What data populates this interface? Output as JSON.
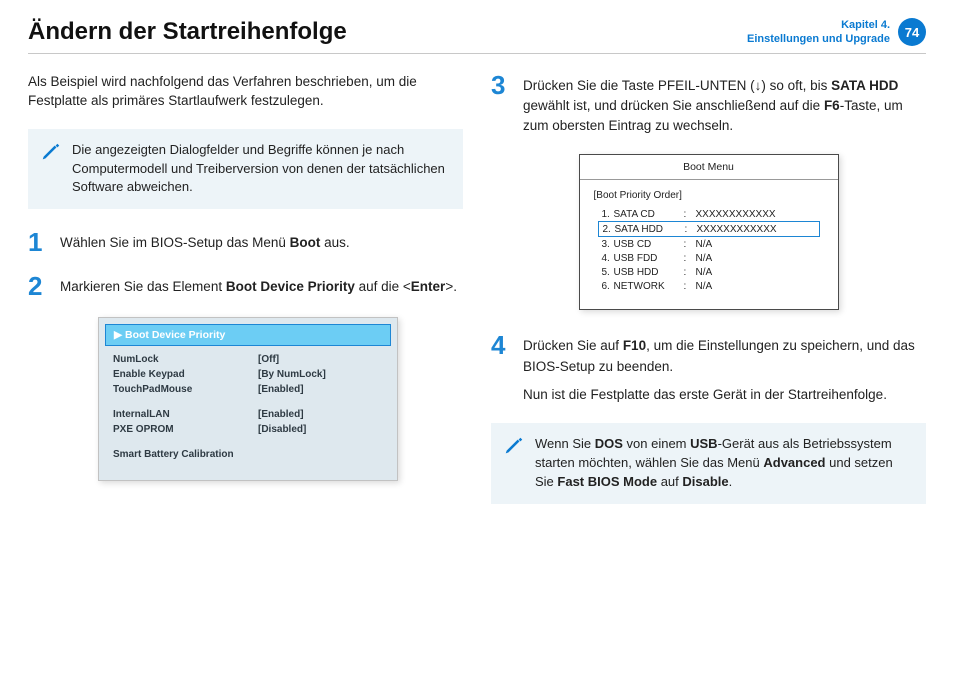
{
  "header": {
    "title": "Ändern der Startreihenfolge",
    "chapter_line1": "Kapitel 4.",
    "chapter_line2": "Einstellungen und Upgrade",
    "page_number": "74"
  },
  "left": {
    "intro": "Als Beispiel wird nachfolgend das Verfahren beschrieben, um die Festplatte als primäres Startlaufwerk festzulegen.",
    "note": "Die angezeigten Dialogfelder und Begriffe können je nach Computermodell und Treiberversion von denen der tatsächlichen Software abweichen.",
    "step1_num": "1",
    "step1_a": "Wählen Sie im BIOS-Setup das Menü ",
    "step1_b": "Boot",
    "step1_c": " aus.",
    "step2_num": "2",
    "step2_a": "Markieren Sie das Element ",
    "step2_b": "Boot Device Priority",
    "step2_c": " auf die <",
    "step2_d": "Enter",
    "step2_e": ">.",
    "bios": {
      "highlight": "▶ Boot Device Priority",
      "rows1": [
        {
          "k": "NumLock",
          "v": "[Off]"
        },
        {
          "k": "Enable Keypad",
          "v": "[By NumLock]"
        },
        {
          "k": "TouchPadMouse",
          "v": "[Enabled]"
        }
      ],
      "rows2": [
        {
          "k": "InternalLAN",
          "v": "[Enabled]"
        },
        {
          "k": "PXE OPROM",
          "v": "[Disabled]"
        }
      ],
      "rows3": [
        {
          "k": "Smart Battery Calibration",
          "v": ""
        }
      ]
    }
  },
  "right": {
    "step3_num": "3",
    "step3_a": "Drücken Sie die Taste PFEIL-UNTEN (↓) so oft, bis ",
    "step3_b": "SATA HDD",
    "step3_c": " gewählt ist, und drücken Sie anschließend auf die ",
    "step3_d": "F6",
    "step3_e": "-Taste, um zum obersten Eintrag zu wechseln.",
    "boot": {
      "title": "Boot Menu",
      "sub": "[Boot Priority Order]",
      "rows": [
        {
          "idx": "1.",
          "name": "SATA CD",
          "val": "XXXXXXXXXXXX",
          "hi": false
        },
        {
          "idx": "2.",
          "name": "SATA HDD",
          "val": "XXXXXXXXXXXX",
          "hi": true
        },
        {
          "idx": "3.",
          "name": "USB CD",
          "val": "N/A",
          "hi": false
        },
        {
          "idx": "4.",
          "name": "USB FDD",
          "val": "N/A",
          "hi": false
        },
        {
          "idx": "5.",
          "name": "USB HDD",
          "val": "N/A",
          "hi": false
        },
        {
          "idx": "6.",
          "name": "NETWORK",
          "val": "N/A",
          "hi": false
        }
      ]
    },
    "step4_num": "4",
    "step4_a": "Drücken Sie auf ",
    "step4_b": "F10",
    "step4_c": ", um die Einstellungen zu speichern, und das BIOS-Setup zu beenden.",
    "step4_p2": "Nun ist die Festplatte das erste Gerät in der Startreihenfolge.",
    "note_a": "Wenn Sie ",
    "note_b": "DOS",
    "note_c": " von einem ",
    "note_d": "USB",
    "note_e": "-Gerät aus als Betriebssystem starten möchten, wählen Sie das Menü ",
    "note_f": "Advanced",
    "note_g": " und setzen Sie ",
    "note_h": "Fast BIOS Mode",
    "note_i": " auf ",
    "note_j": "Disable",
    "note_k": "."
  }
}
